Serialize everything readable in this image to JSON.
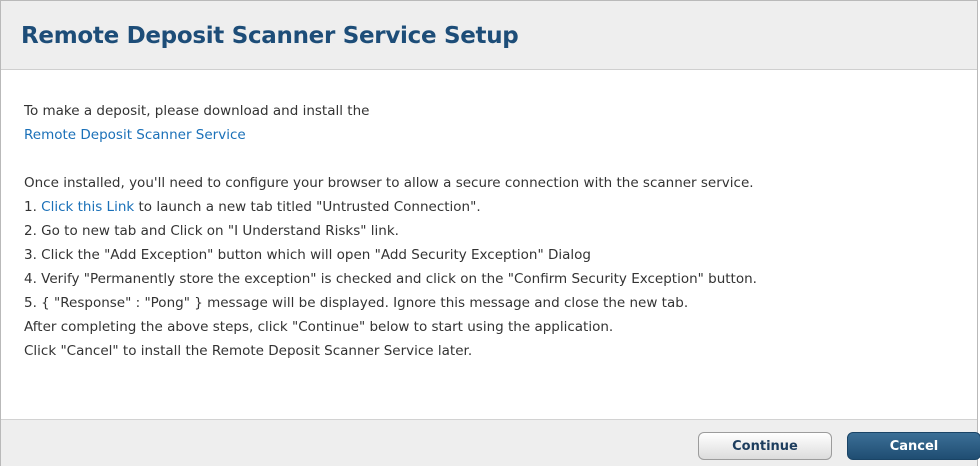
{
  "dialog": {
    "title": "Remote Deposit Scanner Service Setup",
    "intro_text": "To make a deposit, please download and install the",
    "download_link": "Remote Deposit Scanner Service",
    "instructions_intro": "Once installed, you'll need to configure your browser to allow a secure connection with the scanner service.",
    "step1_prefix": "1. ",
    "step1_link": "Click this Link",
    "step1_suffix": " to launch a new tab titled \"Untrusted Connection\".",
    "step2": "2. Go to new tab and Click on \"I Understand Risks\" link.",
    "step3": "3. Click the \"Add Exception\" button which will open \"Add Security Exception\" Dialog",
    "step4": "4. Verify \"Permanently store the exception\" is checked and click on the \"Confirm Security Exception\" button.",
    "step5": "5. { \"Response\" : \"Pong\" } message will be displayed. Ignore this message and close the new tab.",
    "after_text": "After completing the above steps, click \"Continue\" below to start using the application.",
    "cancel_text": "Click \"Cancel\" to install the Remote Deposit Scanner Service later."
  },
  "buttons": {
    "continue_label": "Continue",
    "cancel_label": "Cancel"
  },
  "colors": {
    "title": "#1d4d78",
    "link": "#1a70b8",
    "header_bg": "#eeeeee",
    "cancel_bg": "#2a5a80"
  }
}
